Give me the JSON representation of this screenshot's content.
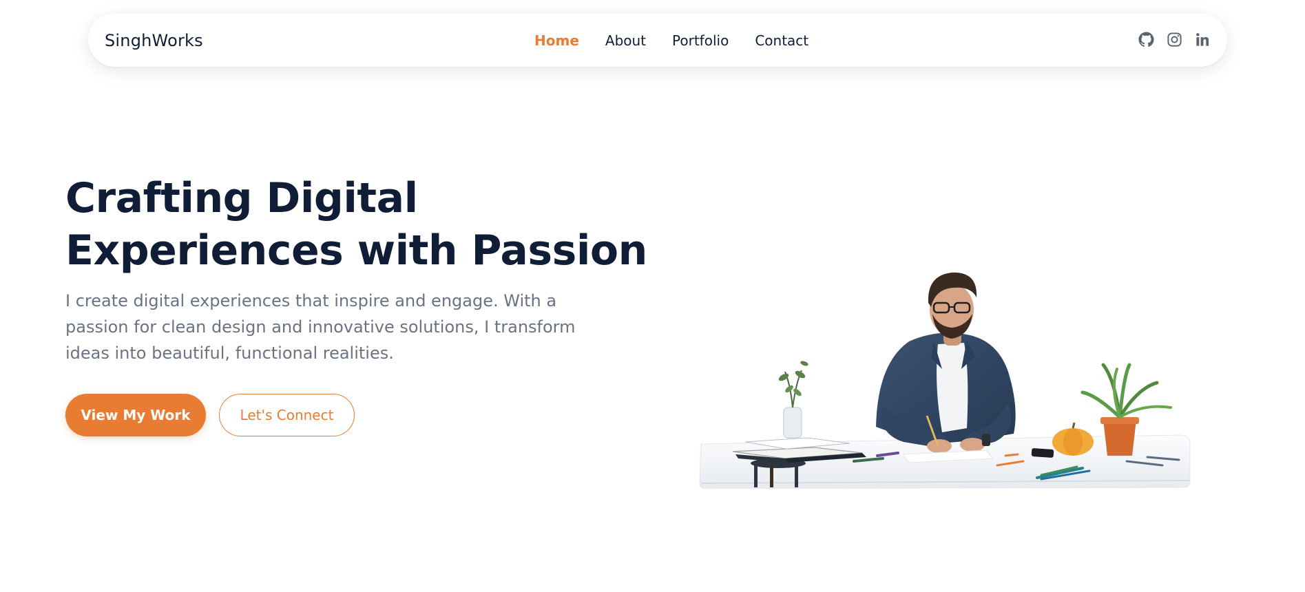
{
  "header": {
    "brand": "SinghWorks",
    "nav": [
      {
        "label": "Home",
        "active": true
      },
      {
        "label": "About",
        "active": false
      },
      {
        "label": "Portfolio",
        "active": false
      },
      {
        "label": "Contact",
        "active": false
      }
    ],
    "socials": [
      {
        "icon": "github-icon"
      },
      {
        "icon": "instagram-icon"
      },
      {
        "icon": "linkedin-icon"
      }
    ]
  },
  "hero": {
    "headline_line1": "Crafting Digital",
    "headline_line2": "Experiences with Passion",
    "subtitle": "I create digital experiences that inspire and engage. With a passion for clean design and innovative solutions, I transform ideas into beautiful, functional realities.",
    "primary_button": "View My Work",
    "secondary_button": "Let's Connect",
    "illustration": "designer-at-desk-illustration"
  },
  "colors": {
    "accent": "#e87c32",
    "heading": "#0f1e36",
    "body_text": "#6a7383",
    "icon": "#5b6270"
  }
}
